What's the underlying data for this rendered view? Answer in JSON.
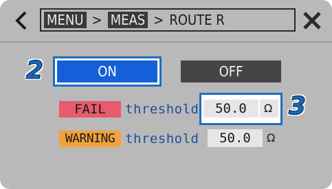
{
  "breadcrumb": {
    "menu": "MENU",
    "separator": ">",
    "meas": "MEAS",
    "current": "ROUTE R"
  },
  "callouts": {
    "step2": "2",
    "step3": "3"
  },
  "toggle": {
    "on_label": "ON",
    "off_label": "OFF",
    "selected": "ON"
  },
  "thresholds": {
    "fail": {
      "tag": "FAIL",
      "label": "threshold",
      "value": "50.0",
      "unit": "Ω"
    },
    "warning": {
      "tag": "WARNING",
      "label": "threshold",
      "value": "50.0",
      "unit": "Ω"
    }
  },
  "icons": [
    "back-chevron-icon",
    "close-icon"
  ],
  "colors": {
    "screen_bg": "#b9b9b9",
    "on_button": "#1560d8",
    "off_button": "#454545",
    "fail_tag": "#e85a6d",
    "warning_tag": "#f2a23c",
    "label_text": "#1e4f9a",
    "callout_frame": "#1a6fbe"
  }
}
